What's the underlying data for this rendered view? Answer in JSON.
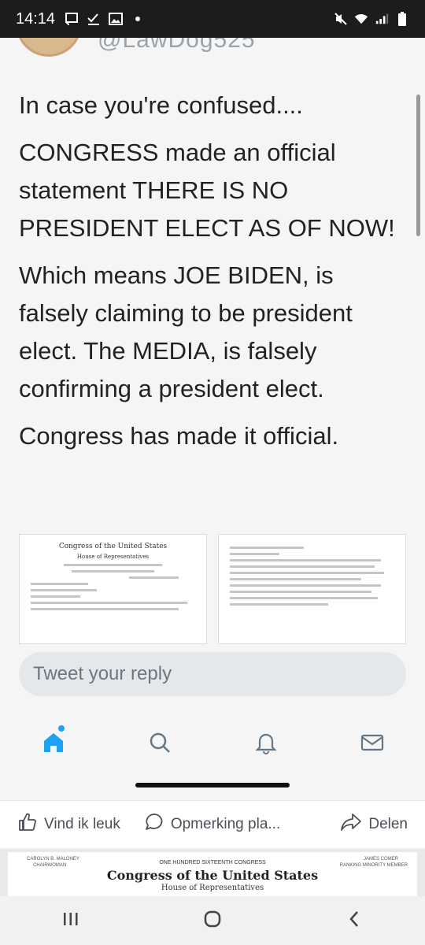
{
  "status_bar": {
    "time": "14:14",
    "left_icons": [
      "cast-icon",
      "download-check-icon",
      "image-icon",
      "dot-icon"
    ],
    "right_icons": [
      "mute-icon",
      "wifi-icon",
      "signal-icon",
      "battery-icon"
    ]
  },
  "tweet": {
    "handle": "@LawDog525",
    "paragraphs": [
      "In case you're confused....",
      "CONGRESS made an official statement THERE IS NO PRESIDENT ELECT AS OF NOW!",
      "Which means JOE BIDEN, is falsely claiming to be president elect. The MEDIA, is falsely confirming a president elect.",
      "Congress has made it official."
    ],
    "doc1_title": "Congress of the United States",
    "doc1_subtitle": "House of Representatives",
    "reply_placeholder": "Tweet your reply",
    "tabs": [
      "home-icon",
      "search-icon",
      "notifications-icon",
      "messages-icon"
    ]
  },
  "fb_actions": {
    "like": "Vind ik leuk",
    "comment": "Opmerking pla...",
    "share": "Delen"
  },
  "next_post": {
    "left_name": "CAROLYN B. MALONEY",
    "left_role": "CHAIRWOMAN",
    "congress_line": "ONE HUNDRED SIXTEENTH CONGRESS",
    "title": "Congress of the United States",
    "subtitle": "House of Representatives",
    "right_name": "JAMES COMER",
    "right_role": "RANKING MINORITY MEMBER"
  },
  "colors": {
    "twitter_blue": "#1da1f2",
    "status_bar_bg": "#1c1c1e",
    "text_dark": "#222222"
  }
}
